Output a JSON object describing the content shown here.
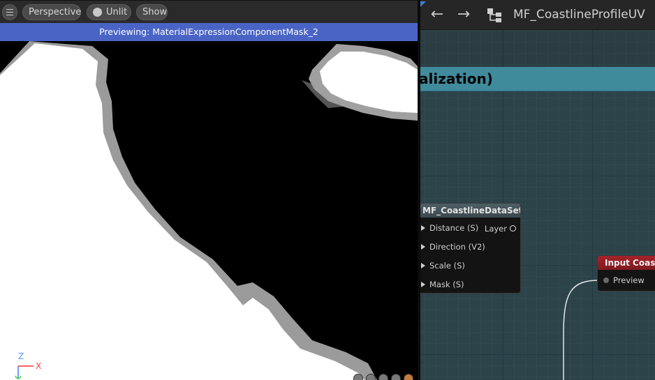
{
  "viewport": {
    "toolbar": {
      "menu_icon": "hamburger-icon",
      "perspective_label": "Perspective",
      "unlit_label": "Unlit",
      "show_label": "Show"
    },
    "preview_banner": "Previewing: MaterialExpressionComponentMask_2",
    "axis": {
      "z_label": "Z",
      "x_label": "X",
      "z_color": "#3a7cff",
      "x_color": "#ff3030"
    }
  },
  "graph": {
    "toolbar": {
      "back_icon": "arrow-left-icon",
      "forward_icon": "arrow-right-icon",
      "hierarchy_icon": "node-hierarchy-icon",
      "title": "MF_CoastlineProfileUV"
    },
    "comment_text": "alization)",
    "function_node": {
      "title": "MF_CoastlineDataSet",
      "inputs": [
        "Distance (S)",
        "Direction (V2)",
        "Scale (S)",
        "Mask (S)"
      ],
      "output": "Layer"
    },
    "input_node": {
      "title": "Input Coastli",
      "pin_label": "Preview",
      "header_color": "#a6232a"
    },
    "comment_color": "#3f8b9c"
  }
}
